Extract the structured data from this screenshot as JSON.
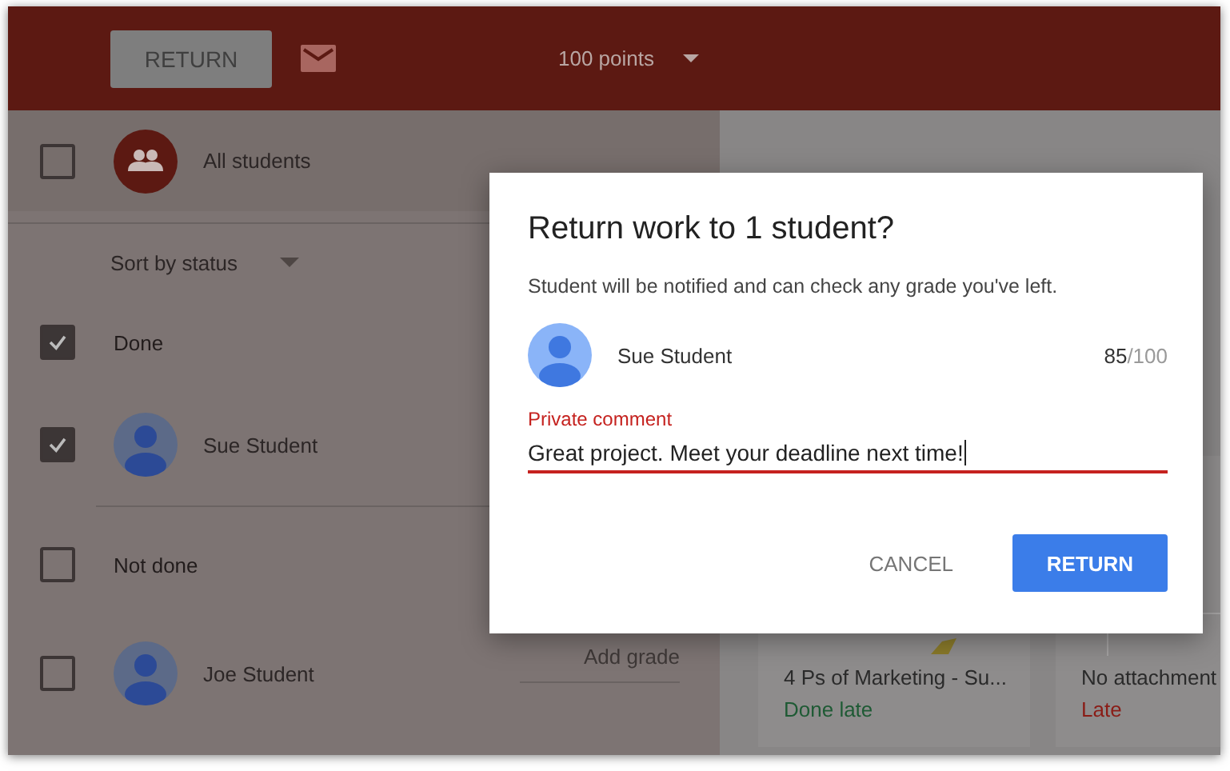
{
  "toolbar": {
    "return_button": "RETURN",
    "points": "100 points"
  },
  "all_students": {
    "label": "All students",
    "checked": false
  },
  "sort": {
    "label": "Sort by status"
  },
  "groups": [
    {
      "label": "Done",
      "checked": true,
      "students": [
        {
          "name": "Sue Student",
          "checked": true
        }
      ]
    },
    {
      "label": "Not done",
      "checked": false,
      "students": [
        {
          "name": "Joe Student",
          "checked": false,
          "grade_placeholder": "Add grade"
        }
      ]
    }
  ],
  "assignment": {
    "cards": [
      {
        "title": "4 Ps of Marketing - Su...",
        "status": "Done late",
        "color": "#1e5a34",
        "kind": "file"
      },
      {
        "title": "No attachment",
        "status": "Late",
        "color": "#8a1c16",
        "kind": "empty"
      }
    ]
  },
  "dialog": {
    "title": "Return work to 1 student?",
    "message": "Student will be notified and can check any grade you've left.",
    "student": "Sue Student",
    "score": "85",
    "total": "/100",
    "comment_label": "Private comment",
    "comment": "Great project. Meet your deadline next time!",
    "buttons": [
      {
        "label": "CANCEL",
        "kind": "text"
      },
      {
        "label": "RETURN",
        "kind": "primary"
      }
    ]
  }
}
